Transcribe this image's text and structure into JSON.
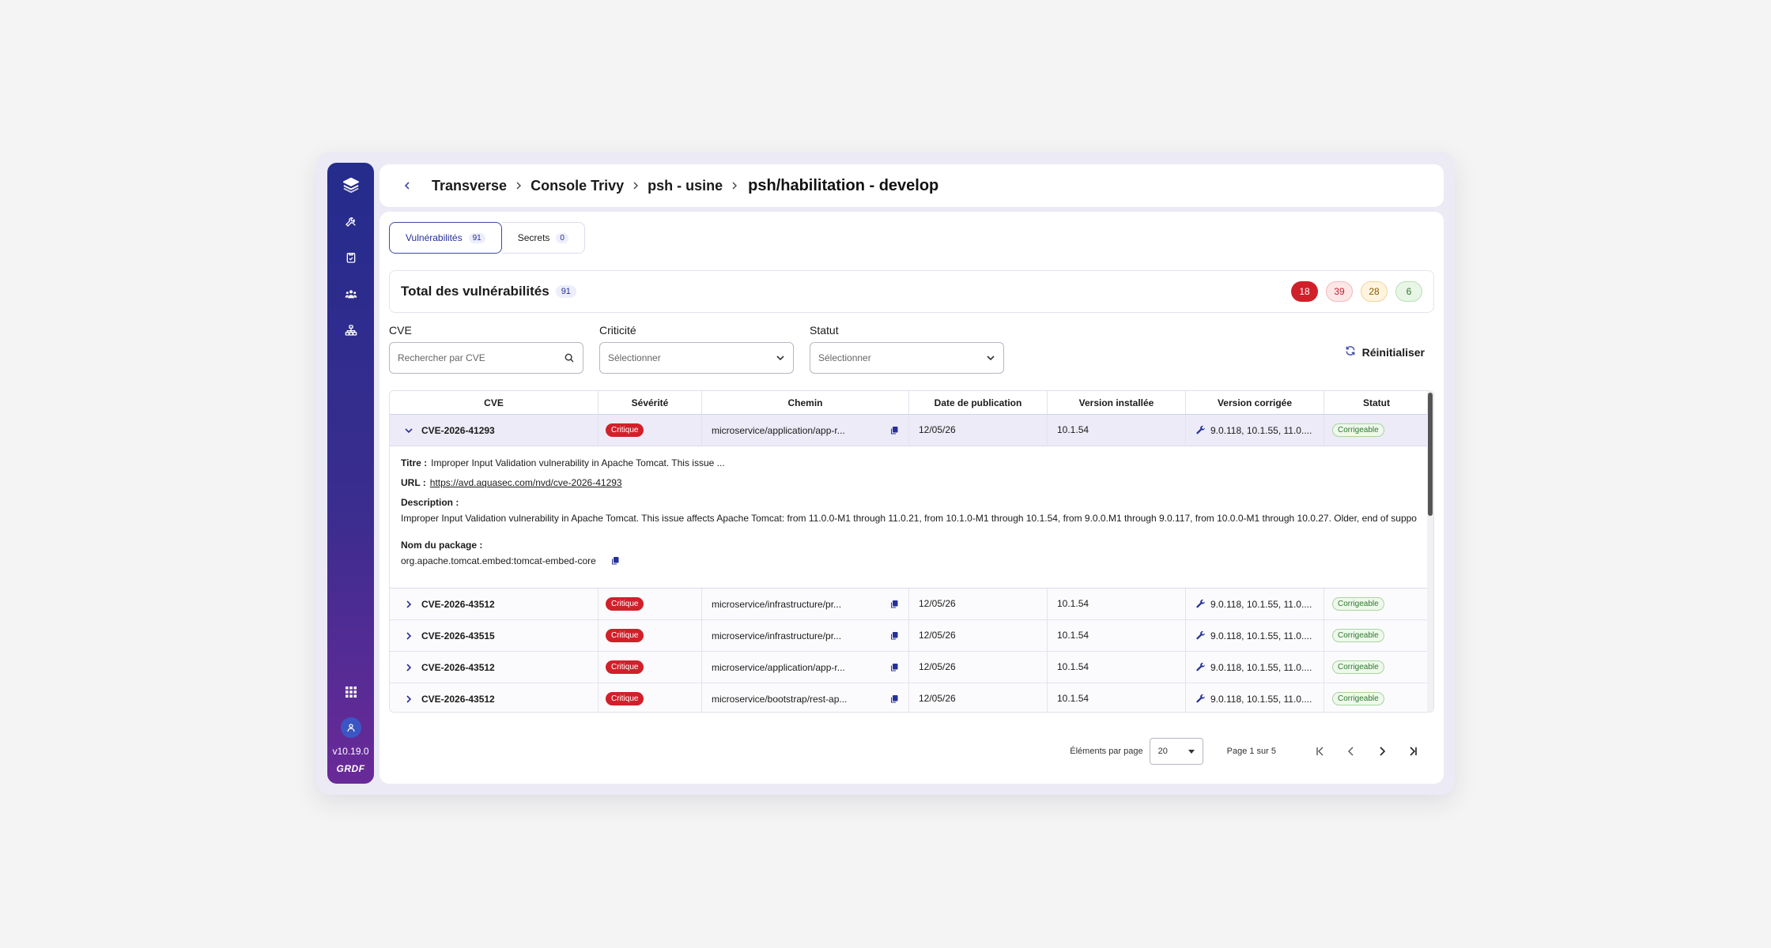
{
  "sidebar": {
    "version": "v10.19.0",
    "brand": "GRDF",
    "icons": [
      "layers-icon",
      "tools-icon",
      "clipboard-check-icon",
      "users-icon",
      "sitemap-icon"
    ]
  },
  "breadcrumb": {
    "items": [
      "Transverse",
      "Console Trivy",
      "psh - usine"
    ],
    "current": "psh/habilitation - develop"
  },
  "tabs": [
    {
      "label": "Vulnérabilités",
      "count": "91"
    },
    {
      "label": "Secrets",
      "count": "0"
    }
  ],
  "summary": {
    "title": "Total des vulnérabilités",
    "count": "91",
    "severity_counts": {
      "critical": "18",
      "high": "39",
      "medium": "28",
      "low": "6"
    },
    "colors": {
      "critical": "#d1202a",
      "high": "#fde6e6",
      "medium": "#fff4df",
      "low": "#e8f6e6"
    }
  },
  "filters": {
    "cve": {
      "label": "CVE",
      "placeholder": "Rechercher par CVE"
    },
    "criticite": {
      "label": "Criticité",
      "value": "Sélectionner"
    },
    "statut": {
      "label": "Statut",
      "value": "Sélectionner"
    },
    "reset_label": "Réinitialiser"
  },
  "table": {
    "headers": [
      "CVE",
      "Sévérité",
      "Chemin",
      "Date de publication",
      "Version installée",
      "Version corrigée",
      "Statut"
    ],
    "rows": [
      {
        "cve": "CVE-2026-41293",
        "severity": "Critique",
        "path": "microservice/application/app-r...",
        "date": "12/05/26",
        "installed": "10.1.54",
        "fixed": "9.0.118, 10.1.55, 11.0....",
        "status": "Corrigeable"
      },
      {
        "cve": "CVE-2026-43512",
        "severity": "Critique",
        "path": "microservice/infrastructure/pr...",
        "date": "12/05/26",
        "installed": "10.1.54",
        "fixed": "9.0.118, 10.1.55, 11.0....",
        "status": "Corrigeable"
      },
      {
        "cve": "CVE-2026-43515",
        "severity": "Critique",
        "path": "microservice/infrastructure/pr...",
        "date": "12/05/26",
        "installed": "10.1.54",
        "fixed": "9.0.118, 10.1.55, 11.0....",
        "status": "Corrigeable"
      },
      {
        "cve": "CVE-2026-43512",
        "severity": "Critique",
        "path": "microservice/application/app-r...",
        "date": "12/05/26",
        "installed": "10.1.54",
        "fixed": "9.0.118, 10.1.55, 11.0....",
        "status": "Corrigeable"
      },
      {
        "cve": "CVE-2026-43512",
        "severity": "Critique",
        "path": "microservice/bootstrap/rest-ap...",
        "date": "12/05/26",
        "installed": "10.1.54",
        "fixed": "9.0.118, 10.1.55, 11.0....",
        "status": "Corrigeable"
      }
    ],
    "detail": {
      "title_label": "Titre :",
      "title": "Improper Input Validation vulnerability in Apache Tomcat. This issue ...",
      "url_label": "URL :",
      "url": "https://avd.aquasec.com/nvd/cve-2026-41293",
      "description_label": "Description :",
      "description": "Improper Input Validation vulnerability in Apache Tomcat. This issue affects Apache Tomcat: from 11.0.0-M1 through 11.0.21, from 10.1.0-M1 through 10.1.54, from 9.0.0.M1 through 9.0.117, from 10.0.0-M1 through 10.0.27. Older, end of suppo",
      "package_label": "Nom du package :",
      "package": "org.apache.tomcat.embed:tomcat-embed-core"
    }
  },
  "pagination": {
    "per_page_label": "Éléments par page",
    "per_page": "20",
    "page_info": "Page 1 sur 5"
  }
}
